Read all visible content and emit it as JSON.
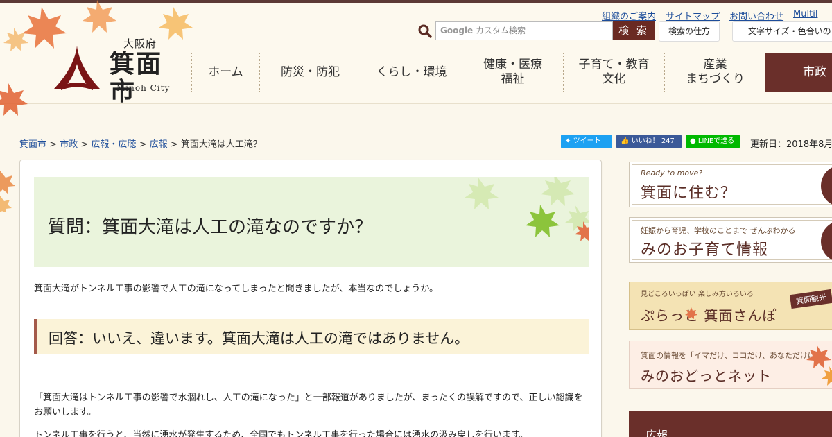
{
  "header": {
    "logo": {
      "pref": "大阪府",
      "city": "箕面市",
      "en": "Minoh City"
    },
    "util_links": [
      "組織のご案内",
      "サイトマップ",
      "お問い合わせ",
      "Multil"
    ],
    "search": {
      "brand": "Google",
      "placeholder": "カスタム検索",
      "button": "検 索",
      "how_label": "検索の仕方",
      "font_label": "文字サイズ・色合いの"
    },
    "nav": [
      {
        "line1": "ホーム",
        "line2": ""
      },
      {
        "line1": "防災・防犯",
        "line2": ""
      },
      {
        "line1": "くらし・環境",
        "line2": ""
      },
      {
        "line1": "健康・医療",
        "line2": "福祉"
      },
      {
        "line1": "子育て・教育",
        "line2": "文化"
      },
      {
        "line1": "産業",
        "line2": "まちづくり"
      },
      {
        "line1": "市政",
        "line2": ""
      }
    ]
  },
  "breadcrumb": {
    "items": [
      "箕面市",
      "市政",
      "広報・広聴",
      "広報"
    ],
    "current": "箕面大滝は人工滝？",
    "sep": ">"
  },
  "share": {
    "tweet": "ツイート",
    "like": "いいね！",
    "like_count": "247",
    "line": "LINEで送る"
  },
  "updated": "更新日：2018年8月",
  "article": {
    "question_title": "質問：箕面大滝は人工の滝なのですか？",
    "question_text": "箕面大滝がトンネル工事の影響で人工の滝になってしまったと聞きましたが、本当なのでしょうか。",
    "answer_title": "回答：いいえ、違います。箕面大滝は人工の滝ではありません。",
    "paragraph1": "「箕面大滝はトンネル工事の影響で水涸れし、人工の滝になった」と一部報道がありましたが、まったくの誤解ですので、正しい認識をお願いします。",
    "paragraph2": "トンネル工事を行うと、当然に湧水が発生するため、全国でもトンネル工事を行った場合には湧水の汲み戻しを行います。"
  },
  "sidebar": {
    "banners": [
      {
        "small": "Ready to move?",
        "big": "箕面に住む？"
      },
      {
        "small": "妊娠から育児、学校のことまで ぜんぶわかる",
        "big": "みのお子育て情報"
      },
      {
        "small": "見どころいっぱい 楽しみ方いろいろ",
        "big": "ぷらっと 箕面さんぽ",
        "tag": "箕面観光"
      },
      {
        "small": "箕面の情報を「イマだけ、ココだけ、あなただけに！",
        "big": "みのおどっとネット"
      }
    ],
    "section_title": "広報"
  },
  "colors": {
    "brand": "#6a2f2a",
    "link": "#1d4d9a",
    "question_bg": "#eaf4dc",
    "answer_bg": "#fbf3d8"
  }
}
